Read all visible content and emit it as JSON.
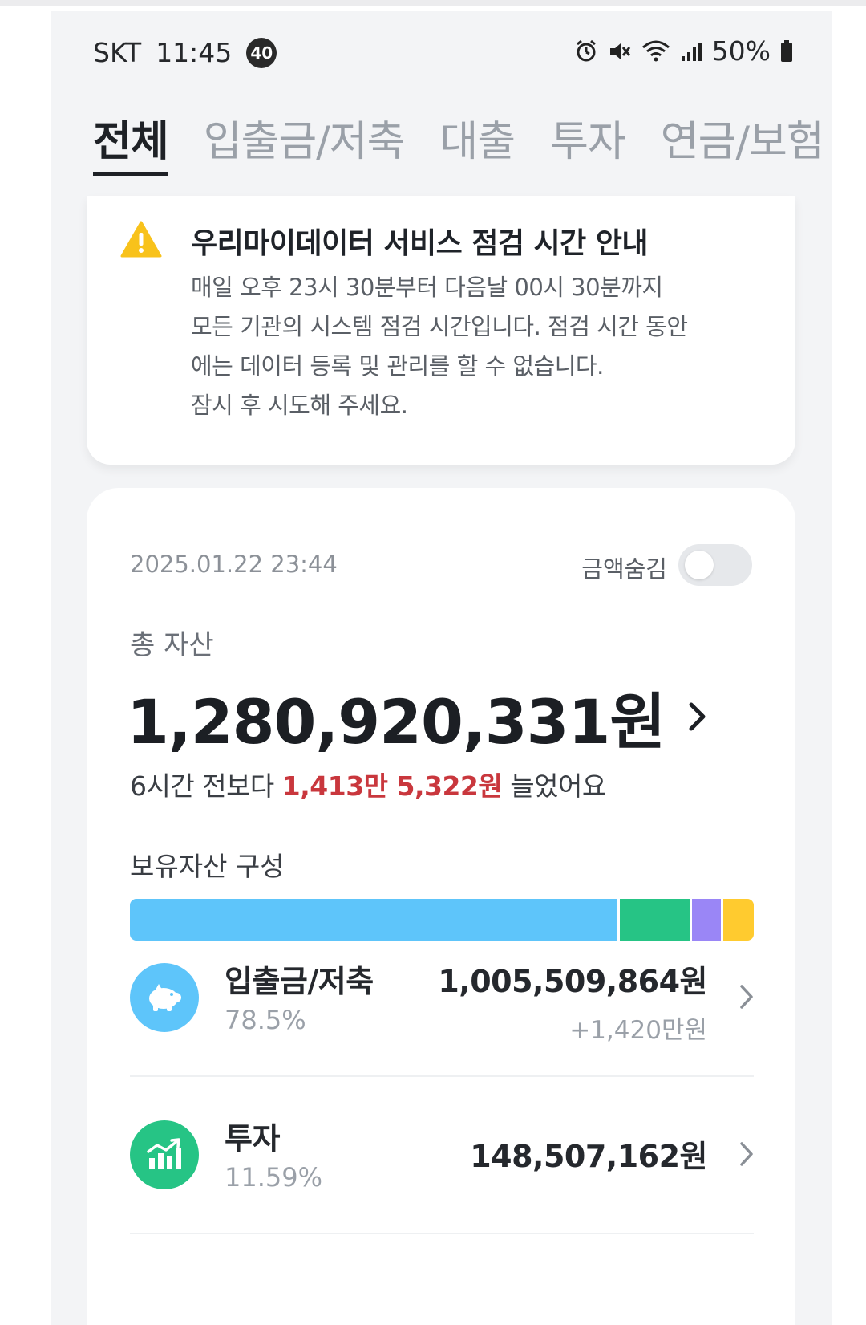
{
  "status_bar": {
    "carrier": "SKT",
    "time": "11:45",
    "badge": "40",
    "battery": "50%"
  },
  "tabs": [
    {
      "label": "전체",
      "active": true
    },
    {
      "label": "입출금/저축",
      "active": false
    },
    {
      "label": "대출",
      "active": false
    },
    {
      "label": "투자",
      "active": false
    },
    {
      "label": "연금/보험",
      "active": false
    }
  ],
  "notice": {
    "icon": "warning-icon",
    "title": "우리마이데이터 서비스 점검 시간 안내",
    "lines": [
      "매일 오후 23시 30분부터 다음날 00시 30분까지",
      "모든 기관의 시스템 점검 시간입니다. 점검 시간 동안",
      "에는 데이터 등록 및 관리를 할 수 없습니다.",
      "잠시 후 시도해 주세요."
    ]
  },
  "summary": {
    "timestamp": "2025.01.22 23:44",
    "hide_amount_label": "금액숨김",
    "hide_amount_on": false,
    "total_label": "총 자산",
    "total_amount": "1,280,920,331원",
    "change_prefix": "6시간 전보다 ",
    "change_value": "1,413만 5,322원",
    "change_suffix": " 늘었어요",
    "composition_label": "보유자산 구성"
  },
  "composition": [
    {
      "percent": 78.5,
      "color": "#5ec5fa"
    },
    {
      "percent": 11.59,
      "color": "#26c485"
    },
    {
      "percent": 5.0,
      "color": "#9a86f6"
    },
    {
      "percent": 4.91,
      "color": "#ffcb2f"
    }
  ],
  "asset_items": [
    {
      "name": "입출금/저축",
      "percent": "78.5%",
      "amount": "1,005,509,864원",
      "delta": "+1,420만원",
      "icon": "piggy-bank-icon",
      "color": "#5ec5fa"
    },
    {
      "name": "투자",
      "percent": "11.59%",
      "amount": "148,507,162원",
      "delta": "",
      "icon": "chart-growth-icon",
      "color": "#26c485"
    }
  ],
  "colors": {
    "increase_red": "#c9373d",
    "background": "#f3f4f6",
    "warning_yellow": "#f8c21b"
  }
}
